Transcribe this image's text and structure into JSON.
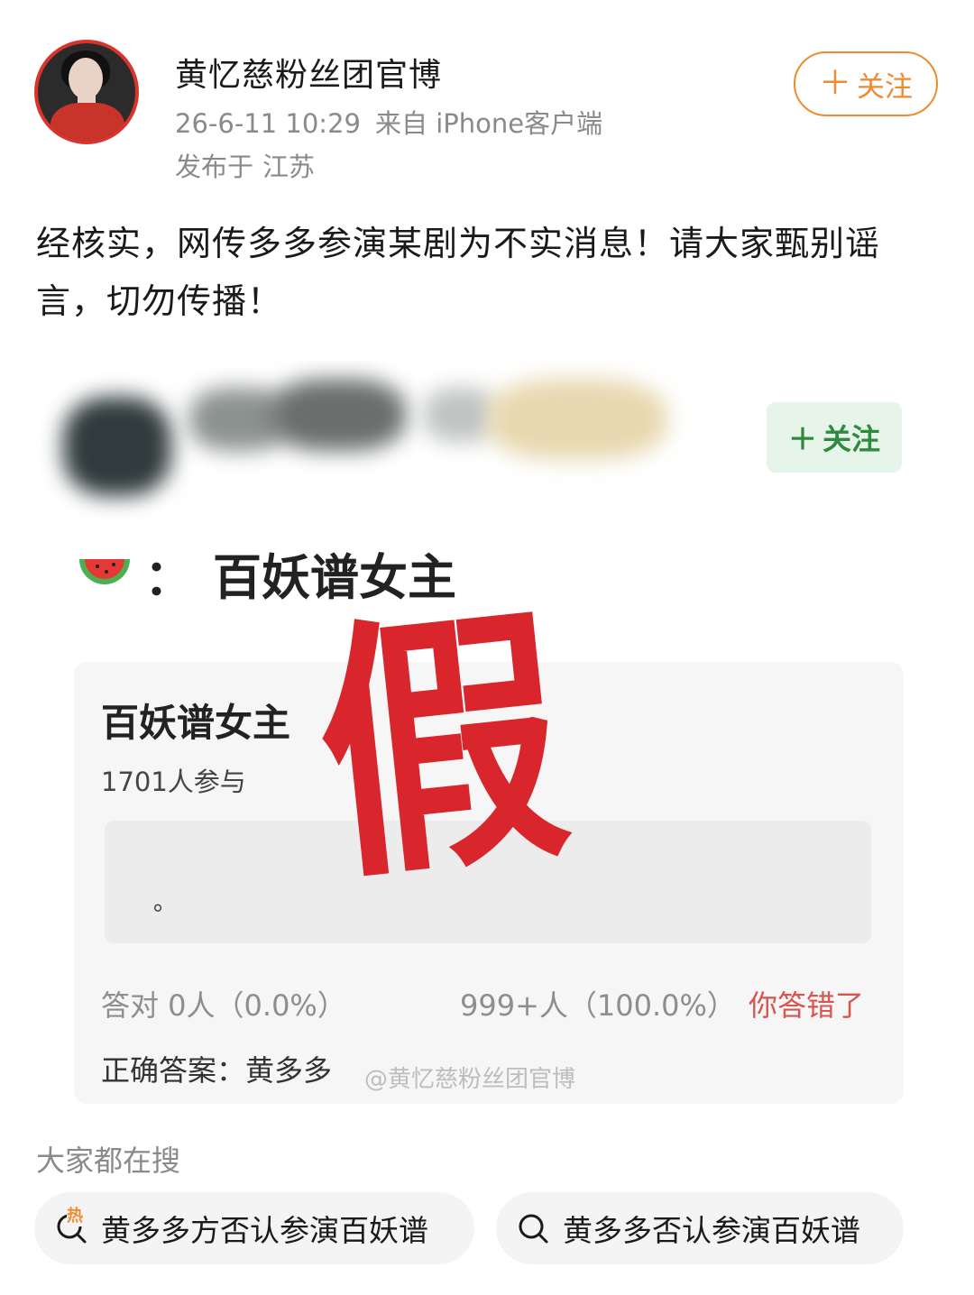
{
  "post": {
    "author_name": "黄忆慈粉丝团官博",
    "timestamp": "26-6-11 10:29",
    "source": "来自 iPhone客户端",
    "location_prefix": "发布于",
    "location": "江苏",
    "follow_label": "关注",
    "text": "经核实，网传多多参演某剧为不实消息！请大家甄别谣言，切勿传播！"
  },
  "shot": {
    "follow_label": "关注",
    "rumor_title": "百妖谱女主",
    "quiz": {
      "title": "百妖谱女主",
      "participants": "1701人参与",
      "option": "。",
      "correct_stats": "答对  0人（0.0%）",
      "wrong_stats": "999+人（100.0%）",
      "wrong_label": "你答错了",
      "answer": "正确答案：黄多多"
    },
    "watermark": "@黄忆慈粉丝团官博",
    "stamp_text": "假"
  },
  "search": {
    "heading": "大家都在搜",
    "hot_badge": "热",
    "items": [
      {
        "label": "黄多多方否认参演百妖谱",
        "icon": "hot-search-icon"
      },
      {
        "label": "黄多多否认参演百妖谱",
        "icon": "search-icon"
      }
    ]
  },
  "colors": {
    "follow_orange": "#f08a30",
    "follow_green": "#2f8a3e",
    "stamp_red": "#d8262c",
    "wrong_red": "#d9534f"
  }
}
